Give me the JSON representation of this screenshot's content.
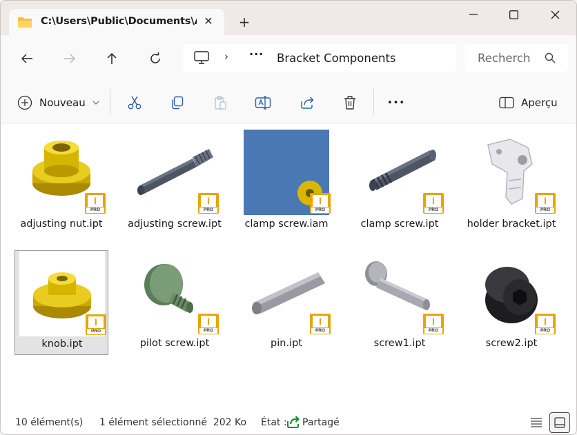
{
  "tab": {
    "title": "C:\\Users\\Public\\Documents\\A",
    "close_glyph": "✕",
    "new_tab_glyph": "+"
  },
  "address": {
    "more": "···",
    "chevron": "›",
    "crumb": "Bracket Components"
  },
  "search": {
    "placeholder": "Recherch"
  },
  "commands": {
    "new_label": "Nouveau",
    "more": "•••",
    "preview_label": "Aperçu"
  },
  "badge": {
    "letter": "I",
    "tag": "PRO"
  },
  "files": [
    {
      "name": "adjusting nut.ipt",
      "icon": "yellow-nut-icon"
    },
    {
      "name": "adjusting screw.ipt",
      "icon": "grey-screw-icon"
    },
    {
      "name": "clamp screw.iam",
      "icon": "assembly-icon"
    },
    {
      "name": "clamp screw.ipt",
      "icon": "threaded-rod-icon"
    },
    {
      "name": "holder bracket.ipt",
      "icon": "bracket-icon"
    },
    {
      "name": "knob.ipt",
      "icon": "yellow-knob-icon",
      "selected": true
    },
    {
      "name": "pilot screw.ipt",
      "icon": "green-screw-icon"
    },
    {
      "name": "pin.ipt",
      "icon": "pin-icon"
    },
    {
      "name": "screw1.ipt",
      "icon": "screw-icon"
    },
    {
      "name": "screw2.ipt",
      "icon": "black-cap-icon"
    }
  ],
  "status": {
    "count": "10 élément(s)",
    "selection": "1 élément sélectionné  202 Ko",
    "state_label": "État :",
    "state_value": "Partagé"
  },
  "colors": {
    "badge": "#e8a500",
    "selection_bg": "#e3e3e3",
    "assembly_bg": "#4a78b5"
  }
}
